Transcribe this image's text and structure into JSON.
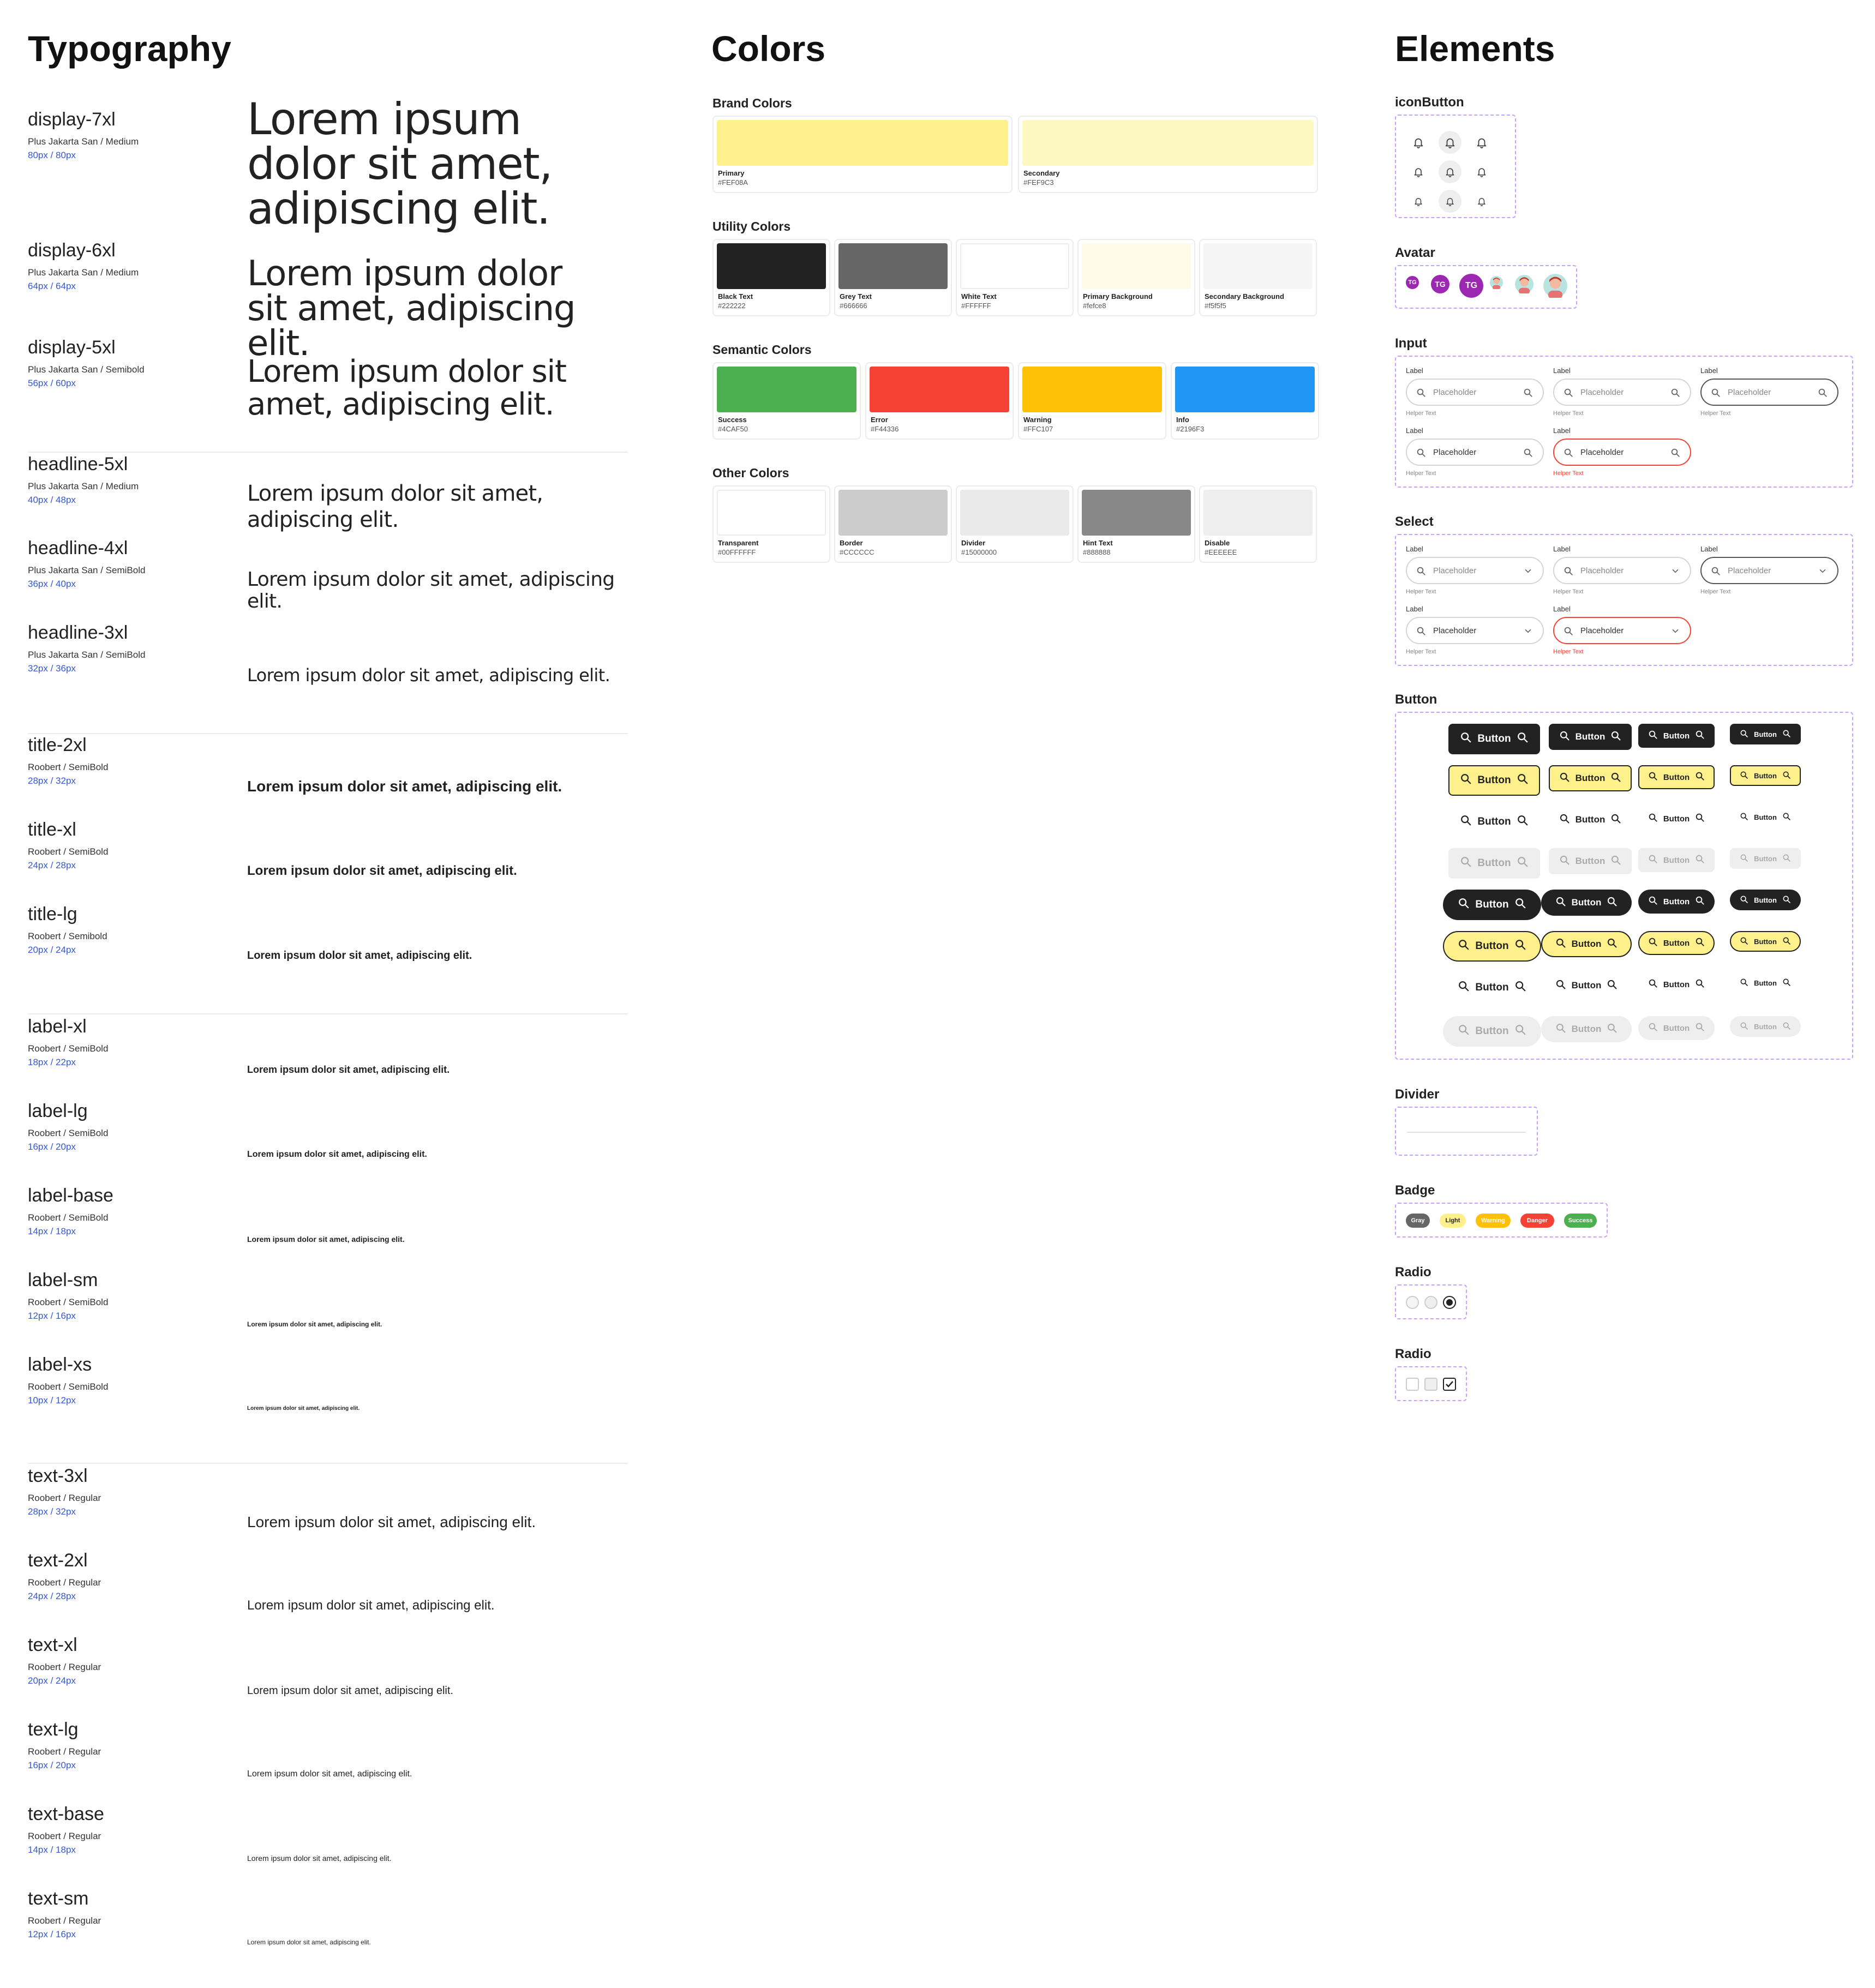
{
  "typography": {
    "title": "Typography",
    "styles": [
      {
        "name": "display-7xl",
        "font": "Plus Jakarta San / Medium",
        "size": "80px / 80px",
        "sample": "Lorem ipsum dolor sit amet, adipiscing elit."
      },
      {
        "name": "display-6xl",
        "font": "Plus Jakarta San / Medium",
        "size": "64px / 64px",
        "sample": "Lorem ipsum dolor sit amet, adipiscing elit."
      },
      {
        "name": "display-5xl",
        "font": "Plus Jakarta San / Semibold",
        "size": "56px / 60px",
        "sample": "Lorem ipsum dolor sit amet, adipiscing elit."
      },
      {
        "name": "headline-5xl",
        "font": "Plus Jakarta San / Medium",
        "size": "40px / 48px",
        "sample": "Lorem ipsum dolor sit amet, adipiscing elit."
      },
      {
        "name": "headline-4xl",
        "font": "Plus Jakarta San / SemiBold",
        "size": "36px / 40px",
        "sample": "Lorem ipsum dolor sit amet, adipiscing elit."
      },
      {
        "name": "headline-3xl",
        "font": "Plus Jakarta San / SemiBold",
        "size": "32px / 36px",
        "sample": "Lorem ipsum dolor sit amet, adipiscing elit."
      },
      {
        "name": "title-2xl",
        "font": "Roobert / SemiBold",
        "size": "28px / 32px",
        "sample": "Lorem ipsum dolor sit amet, adipiscing elit."
      },
      {
        "name": "title-xl",
        "font": "Roobert / SemiBold",
        "size": "24px / 28px",
        "sample": "Lorem ipsum dolor sit amet, adipiscing elit."
      },
      {
        "name": "title-lg",
        "font": "Roobert / Semibold",
        "size": "20px / 24px",
        "sample": "Lorem ipsum dolor sit amet, adipiscing elit."
      },
      {
        "name": "label-xl",
        "font": "Roobert / SemiBold",
        "size": "18px / 22px",
        "sample": "Lorem ipsum dolor sit amet, adipiscing elit."
      },
      {
        "name": "label-lg",
        "font": "Roobert / SemiBold",
        "size": "16px / 20px",
        "sample": "Lorem ipsum dolor sit amet, adipiscing elit."
      },
      {
        "name": "label-base",
        "font": "Roobert / SemiBold",
        "size": "14px / 18px",
        "sample": "Lorem ipsum dolor sit amet, adipiscing elit."
      },
      {
        "name": "label-sm",
        "font": "Roobert / SemiBold",
        "size": "12px / 16px",
        "sample": "Lorem ipsum dolor sit amet, adipiscing elit."
      },
      {
        "name": "label-xs",
        "font": "Roobert / SemiBold",
        "size": "10px / 12px",
        "sample": "Lorem ipsum dolor sit amet, adipiscing elit."
      },
      {
        "name": "text-3xl",
        "font": "Roobert / Regular",
        "size": "28px / 32px",
        "sample": "Lorem ipsum dolor sit amet, adipiscing elit."
      },
      {
        "name": "text-2xl",
        "font": "Roobert / Regular",
        "size": "24px / 28px",
        "sample": "Lorem ipsum dolor sit amet, adipiscing elit."
      },
      {
        "name": "text-xl",
        "font": "Roobert / Regular",
        "size": "20px / 24px",
        "sample": "Lorem ipsum dolor sit amet, adipiscing elit."
      },
      {
        "name": "text-lg",
        "font": "Roobert / Regular",
        "size": "16px / 20px",
        "sample": "Lorem ipsum dolor sit amet, adipiscing elit."
      },
      {
        "name": "text-base",
        "font": "Roobert / Regular",
        "size": "14px / 18px",
        "sample": "Lorem ipsum dolor sit amet, adipiscing elit."
      },
      {
        "name": "text-sm",
        "font": "Roobert / Regular",
        "size": "12px / 16px",
        "sample": "Lorem ipsum dolor sit amet, adipiscing elit."
      }
    ]
  },
  "colors": {
    "title": "Colors",
    "sections": [
      {
        "title": "Brand Colors",
        "swatches": [
          {
            "label": "Primary",
            "hex": "#FEF08A",
            "color": "#FEF08A"
          },
          {
            "label": "Secondary",
            "hex": "#FEF9C3",
            "color": "#FEF9C3"
          }
        ]
      },
      {
        "title": "Utility Colors",
        "swatches": [
          {
            "label": "Black Text",
            "hex": "#222222",
            "color": "#222222"
          },
          {
            "label": "Grey Text",
            "hex": "#666666",
            "color": "#666666"
          },
          {
            "label": "White Text",
            "hex": "#FFFFFF",
            "color": "#FFFFFF"
          },
          {
            "label": "Primary Background",
            "hex": "#fefce8",
            "color": "#fefce8"
          },
          {
            "label": "Secondary Background",
            "hex": "#f5f5f5",
            "color": "#f5f5f5"
          }
        ]
      },
      {
        "title": "Semantic Colors",
        "swatches": [
          {
            "label": "Success",
            "hex": "#4CAF50",
            "color": "#4CAF50"
          },
          {
            "label": "Error",
            "hex": "#F44336",
            "color": "#F44336"
          },
          {
            "label": "Warning",
            "hex": "#FFC107",
            "color": "#FFC107"
          },
          {
            "label": "Info",
            "hex": "#2196F3",
            "color": "#2196F3"
          }
        ]
      },
      {
        "title": "Other Colors",
        "swatches": [
          {
            "label": "Transparent",
            "hex": "#00FFFFFF",
            "color": "#FFFFFF"
          },
          {
            "label": "Border",
            "hex": "#CCCCCC",
            "color": "#CCCCCC"
          },
          {
            "label": "Divider",
            "hex": "#15000000",
            "color": "#EAEAEA"
          },
          {
            "label": "Hint Text",
            "hex": "#888888",
            "color": "#888888"
          },
          {
            "label": "Disable",
            "hex": "#EEEEEE",
            "color": "#EEEEEE"
          }
        ]
      }
    ]
  },
  "elements": {
    "title": "Elements",
    "icon_button": {
      "title": "iconButton",
      "icon": "bell-icon"
    },
    "avatar": {
      "title": "Avatar",
      "initials": "TG",
      "avatar_color": "#9c27b0"
    },
    "input": {
      "title": "Input",
      "label": "Label",
      "placeholder": "Placeholder",
      "helper": "Helper Text"
    },
    "select": {
      "title": "Select",
      "label": "Label",
      "placeholder": "Placeholder",
      "helper": "Helper Text"
    },
    "button": {
      "title": "Button",
      "label": "Button",
      "icon": "search-icon"
    },
    "divider": {
      "title": "Divider"
    },
    "badge": {
      "title": "Badge",
      "items": [
        {
          "label": "Gray",
          "bg": "#666666",
          "fg": "#ffffff"
        },
        {
          "label": "Light",
          "bg": "#FEF08A",
          "fg": "#222222"
        },
        {
          "label": "Warning",
          "bg": "#FFC107",
          "fg": "#ffffff"
        },
        {
          "label": "Danger",
          "bg": "#F44336",
          "fg": "#ffffff"
        },
        {
          "label": "Success",
          "bg": "#4CAF50",
          "fg": "#ffffff"
        }
      ]
    },
    "radio": {
      "title": "Radio"
    },
    "checkbox": {
      "title": "Radio"
    }
  },
  "colors_accent": {
    "error": "#F44336",
    "dashed_border": "#c9a0ff",
    "link_blue": "#3358d4"
  }
}
